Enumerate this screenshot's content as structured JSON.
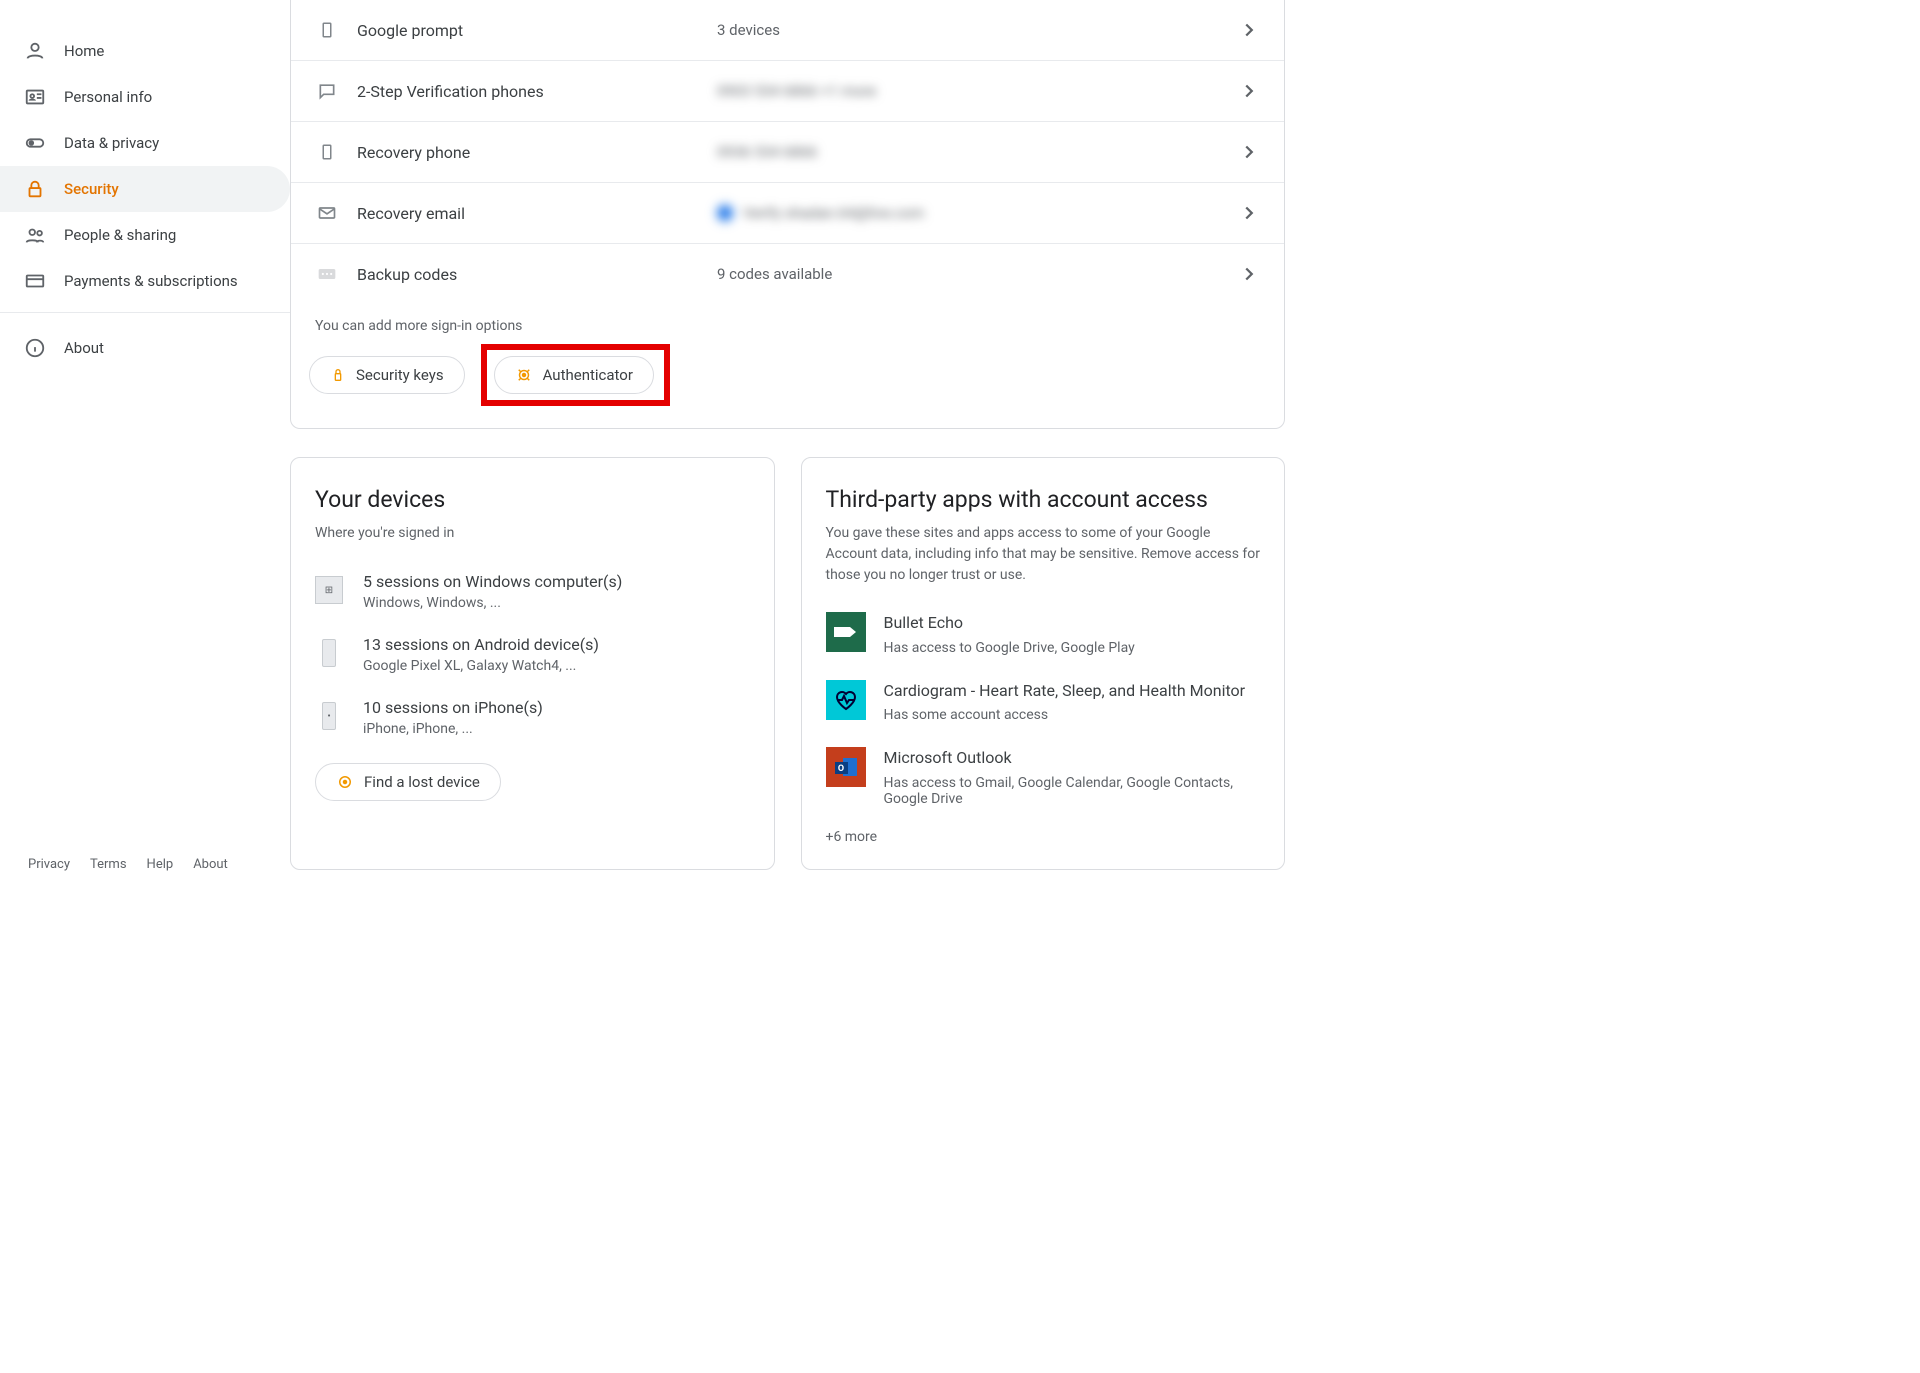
{
  "sidebar": {
    "items": [
      {
        "label": "Home"
      },
      {
        "label": "Personal info"
      },
      {
        "label": "Data & privacy"
      },
      {
        "label": "Security"
      },
      {
        "label": "People & sharing"
      },
      {
        "label": "Payments & subscriptions"
      },
      {
        "label": "About"
      }
    ]
  },
  "footer": {
    "privacy": "Privacy",
    "terms": "Terms",
    "help": "Help",
    "about": "About"
  },
  "signin": {
    "options": [
      {
        "label": "Google prompt",
        "value": "3 devices"
      },
      {
        "label": "2-Step Verification phones",
        "value": "0903 534 6866 +1 more"
      },
      {
        "label": "Recovery phone",
        "value": "0936 534 6866"
      },
      {
        "label": "Recovery email",
        "value": "Verify shadan.64@live.com"
      },
      {
        "label": "Backup codes",
        "value": "9 codes available"
      }
    ],
    "more_text": "You can add more sign-in options",
    "chip_security_keys": "Security keys",
    "chip_authenticator": "Authenticator"
  },
  "devices": {
    "title": "Your devices",
    "subtitle": "Where you're signed in",
    "items": [
      {
        "title": "5 sessions on Windows computer(s)",
        "sub": "Windows, Windows, ..."
      },
      {
        "title": "13 sessions on Android device(s)",
        "sub": "Google Pixel XL, Galaxy Watch4, ..."
      },
      {
        "title": "10 sessions on iPhone(s)",
        "sub": "iPhone, iPhone, ..."
      }
    ],
    "find_label": "Find a lost device"
  },
  "thirdparty": {
    "title": "Third-party apps with account access",
    "desc": "You gave these sites and apps access to some of your Google Account data, including info that may be sensitive. Remove access for those you no longer trust or use.",
    "items": [
      {
        "title": "Bullet Echo",
        "sub": "Has access to Google Drive, Google Play"
      },
      {
        "title": "Cardiogram - Heart Rate, Sleep, and Health Monitor",
        "sub": "Has some account access"
      },
      {
        "title": "Microsoft Outlook",
        "sub": "Has access to Gmail, Google Calendar, Google Contacts, Google Drive"
      }
    ],
    "more": "+6 more"
  }
}
